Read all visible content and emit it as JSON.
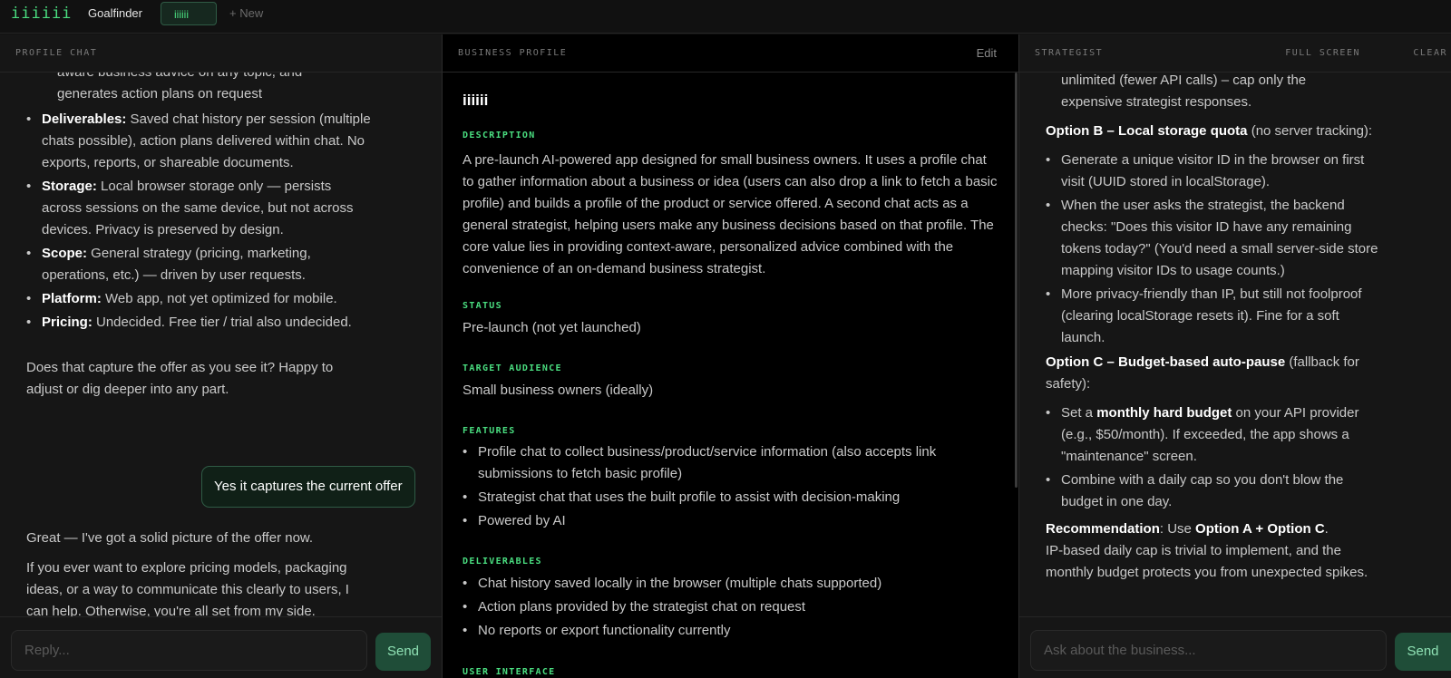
{
  "app": {
    "logo": "iiiiii",
    "tabs": [
      {
        "label": "Goalfinder"
      },
      {
        "label": "iiiiii"
      },
      {
        "label": "+ New"
      }
    ]
  },
  "profile_chat": {
    "header": "PROFILE CHAT",
    "top_partial_line1": "aware business advice on any topic, and",
    "top_partial_line2": "generates action plans on request",
    "bullets": [
      {
        "key": "Deliverables:",
        "text": " Saved chat history per session (multiple chats possible), action plans delivered within chat. No exports, reports, or shareable documents."
      },
      {
        "key": "Storage:",
        "text": " Local browser storage only — persists across sessions on the same device, but not across devices. Privacy is preserved by design."
      },
      {
        "key": "Scope:",
        "text": " General strategy (pricing, marketing, operations, etc.) — driven by user requests."
      },
      {
        "key": "Platform:",
        "text": " Web app, not yet optimized for mobile."
      },
      {
        "key": "Pricing:",
        "text": " Undecided. Free tier / trial also undecided."
      }
    ],
    "question": "Does that capture the offer as you see it? Happy to adjust or dig deeper into any part.",
    "user_message": "Yes it captures the current offer",
    "reply_1": "Great — I've got a solid picture of the offer now.",
    "reply_2": "If you ever want to explore pricing models, packaging ideas, or a way to communicate this clearly to users, I can help. Otherwise, you're all set from my side.",
    "input_placeholder": "Reply...",
    "send_label": "Send"
  },
  "business_profile": {
    "header": "BUSINESS PROFILE",
    "edit_label": "Edit",
    "name": "iiiiii",
    "description_label": "DESCRIPTION",
    "description": "A pre-launch AI-powered app designed for small business owners. It uses a profile chat to gather information about a business or idea (users can also drop a link to fetch a basic profile) and builds a profile of the product or service offered. A second chat acts as a general strategist, helping users make any business decisions based on that profile. The core value lies in providing context-aware, personalized advice combined with the convenience of an on-demand business strategist.",
    "status_label": "STATUS",
    "status": "Pre-launch (not yet launched)",
    "audience_label": "TARGET AUDIENCE",
    "audience": "Small business owners (ideally)",
    "features_label": "FEATURES",
    "features": [
      "Profile chat to collect business/product/service information (also accepts link submissions to fetch basic profile)",
      "Strategist chat that uses the built profile to assist with decision-making",
      "Powered by AI"
    ],
    "deliverables_label": "DELIVERABLES",
    "deliverables": [
      "Chat history saved locally in the browser (multiple chats supported)",
      "Action plans provided by the strategist chat on request",
      "No reports or export functionality currently"
    ],
    "ui_label": "USER INTERFACE"
  },
  "strategist": {
    "header": "STRATEGIST",
    "full_screen_label": "FULL SCREEN",
    "clear_label": "CLEAR",
    "top_partial_line1": "unlimited (fewer API calls) – cap only the",
    "top_partial_line2": "expensive strategist responses.",
    "option_b_title": "Option B – Local storage quota",
    "option_b_note": " (no server tracking):",
    "option_b_bullets": [
      "Generate a unique visitor ID in the browser on first visit (UUID stored in localStorage).",
      "When the user asks the strategist, the backend checks: \"Does this visitor ID have any remaining tokens today?\" (You'd need a small server-side store mapping visitor IDs to usage counts.)",
      "More privacy-friendly than IP, but still not foolproof (clearing localStorage resets it). Fine for a soft launch."
    ],
    "option_c_title": "Option C – Budget-based auto-pause",
    "option_c_note": " (fallback for safety):",
    "option_c_b1_pre": "Set a ",
    "option_c_b1_bold": "monthly hard budget",
    "option_c_b1_post": " on your API provider (e.g., $50/month). If exceeded, the app shows a \"maintenance\" screen.",
    "option_c_b2": "Combine with a daily cap so you don't blow the budget in one day.",
    "rec_label": "Recommendation",
    "rec_mid": ": Use ",
    "rec_bold": "Option A + Option C",
    "rec_end": ".",
    "rec_text": "IP-based daily cap is trivial to implement, and the monthly budget protects you from unexpected spikes.",
    "input_placeholder": "Ask about the business...",
    "send_label": "Send"
  },
  "colors": {
    "accent": "#4ade80",
    "background": "#111111",
    "panel_dark": "#000000",
    "send_button": "#1f4d38"
  }
}
